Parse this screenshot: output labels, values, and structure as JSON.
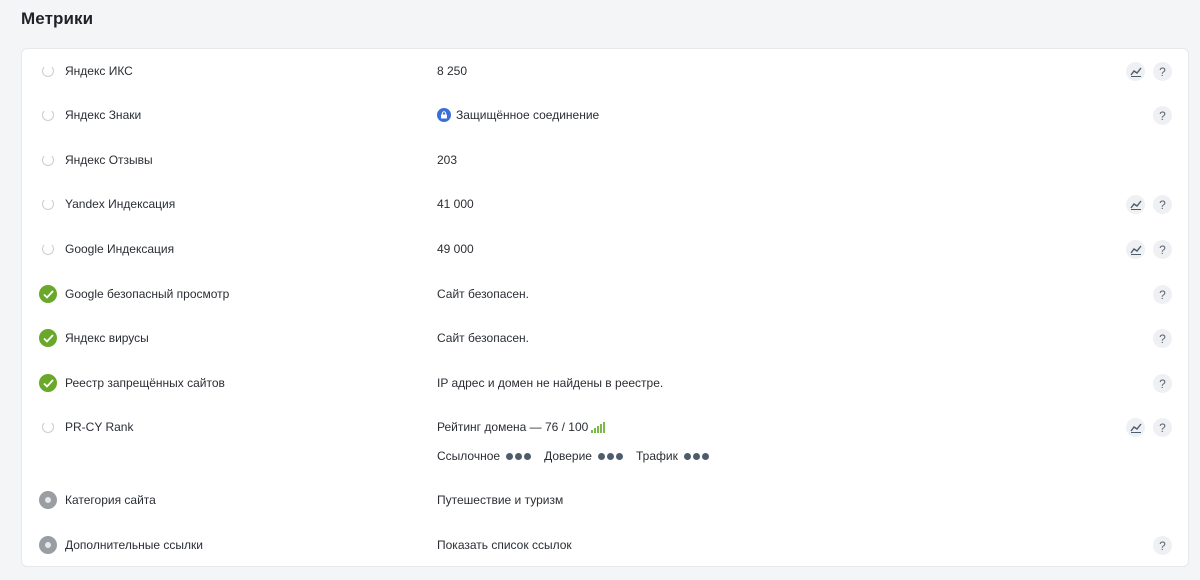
{
  "page": {
    "title": "Метрики"
  },
  "rows": [
    {
      "status": "loading",
      "name": "Яндекс ИКС",
      "value": "8 250",
      "chart": true,
      "help": true
    },
    {
      "status": "loading",
      "name": "Яндекс Знаки",
      "value": "Защищённое соединение",
      "icon": "lock-icon",
      "chart": false,
      "help": true
    },
    {
      "status": "loading",
      "name": "Яндекс Отзывы",
      "value": "203",
      "chart": false,
      "help": false
    },
    {
      "status": "loading",
      "name": "Yandex Индексация",
      "value": "41 000",
      "chart": true,
      "help": true
    },
    {
      "status": "loading",
      "name": "Google Индексация",
      "value": "49 000",
      "chart": true,
      "help": true
    },
    {
      "status": "ok",
      "name": "Google безопасный просмотр",
      "value": "Сайт безопасен.",
      "chart": false,
      "help": true
    },
    {
      "status": "ok",
      "name": "Яндекс вирусы",
      "value": "Сайт безопасен.",
      "chart": false,
      "help": true
    },
    {
      "status": "ok",
      "name": "Реестр запрещённых сайтов",
      "value": "IP адрес и домен не найдены в реестре.",
      "chart": false,
      "help": true
    },
    {
      "status": "loading",
      "name": "PR-CY Rank",
      "value": "Рейтинг домена — 76 / 100",
      "chart": true,
      "help": true,
      "sub": [
        {
          "label": "Ссылочное",
          "dots": 3
        },
        {
          "label": "Доверие",
          "dots": 3
        },
        {
          "label": "Трафик",
          "dots": 3
        }
      ]
    },
    {
      "status": "neutral",
      "name": "Категория сайта",
      "value": "Путешествие и туризм",
      "chart": false,
      "help": false
    },
    {
      "status": "neutral",
      "name": "Дополнительные ссылки",
      "value": "Показать список ссылок",
      "chart": false,
      "help": true
    }
  ],
  "help_label": "?",
  "colors": {
    "ok": "#6aa82a",
    "lock": "#3b6fd8",
    "signal": "#7cb84a",
    "dots": "#4e5d6c"
  }
}
